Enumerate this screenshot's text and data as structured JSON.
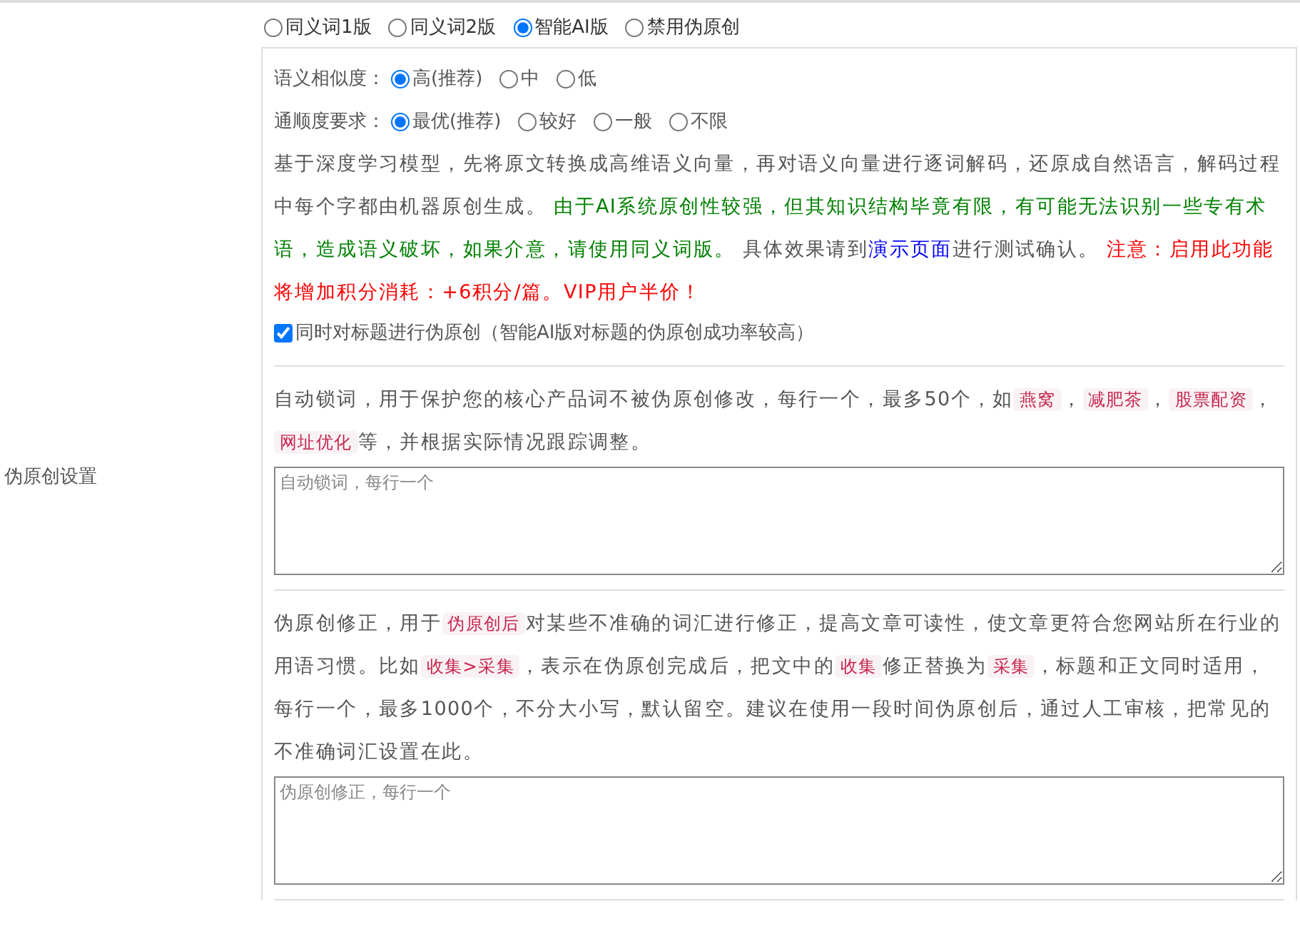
{
  "side_label": "伪原创设置",
  "mode_options": [
    {
      "label": "同义词1版",
      "selected": false
    },
    {
      "label": "同义词2版",
      "selected": false
    },
    {
      "label": "智能AI版",
      "selected": true
    },
    {
      "label": "禁用伪原创",
      "selected": false
    }
  ],
  "ai_panel": {
    "settings": [
      {
        "label": "语义相似度：",
        "options": [
          {
            "label": "高(推荐)",
            "selected": true
          },
          {
            "label": "中",
            "selected": false
          },
          {
            "label": "低",
            "selected": false
          }
        ]
      },
      {
        "label": "通顺度要求：",
        "options": [
          {
            "label": "最优(推荐)",
            "selected": true
          },
          {
            "label": "较好",
            "selected": false
          },
          {
            "label": "一般",
            "selected": false
          },
          {
            "label": "不限",
            "selected": false
          }
        ]
      }
    ],
    "description": [
      {
        "kind": "text",
        "text": "基于深度学习模型，先将原文转换成高维语义向量，再对语义向量进行逐词解码，还原成自然语言，解码过程中每个字都由机器原创生成。 "
      },
      {
        "kind": "green",
        "text": "由于AI系统原创性较强，但其知识结构毕竟有限，有可能无法识别一些专有术语，造成语义破坏，如果介意，请使用同义词版。"
      },
      {
        "kind": "text",
        "text": " 具体效果请到"
      },
      {
        "kind": "link",
        "text": "演示页面"
      },
      {
        "kind": "text",
        "text": "进行测试确认。 "
      },
      {
        "kind": "red",
        "text": "注意：启用此功能将增加积分消耗：+6积分/篇。VIP用户半价！"
      }
    ],
    "title_checkbox": {
      "label": "同时对标题进行伪原创（智能AI版对标题的伪原创成功率较高）",
      "checked": true
    }
  },
  "lock_words": {
    "description": [
      {
        "kind": "text",
        "text": "自动锁词，用于保护您的核心产品词不被伪原创修改，每行一个，最多50个，如"
      },
      {
        "kind": "tag",
        "text": "燕窝"
      },
      {
        "kind": "text",
        "text": "，"
      },
      {
        "kind": "tag",
        "text": "减肥茶"
      },
      {
        "kind": "text",
        "text": "，"
      },
      {
        "kind": "tag",
        "text": "股票配资"
      },
      {
        "kind": "text",
        "text": "，"
      },
      {
        "kind": "tag",
        "text": "网址优化"
      },
      {
        "kind": "text",
        "text": "等，并根据实际情况跟踪调整。"
      }
    ],
    "placeholder": "自动锁词，每行一个"
  },
  "correction": {
    "description": [
      {
        "kind": "text",
        "text": "伪原创修正，用于"
      },
      {
        "kind": "tag",
        "text": "伪原创后"
      },
      {
        "kind": "text",
        "text": "对某些不准确的词汇进行修正，提高文章可读性，使文章更符合您网站所在行业的用语习惯。比如"
      },
      {
        "kind": "tag",
        "text": "收集>采集"
      },
      {
        "kind": "text",
        "text": "，表示在伪原创完成后，把文中的"
      },
      {
        "kind": "tag",
        "text": "收集"
      },
      {
        "kind": "text",
        "text": "修正替换为"
      },
      {
        "kind": "tag",
        "text": "采集"
      },
      {
        "kind": "text",
        "text": "，标题和正文同时适用，每行一个，最多1000个，不分大小写，默认留空。建议在使用一段时间伪原创后，通过人工审核，把常见的不准确词汇设置在此。"
      }
    ],
    "placeholder": "伪原创修正，每行一个"
  }
}
